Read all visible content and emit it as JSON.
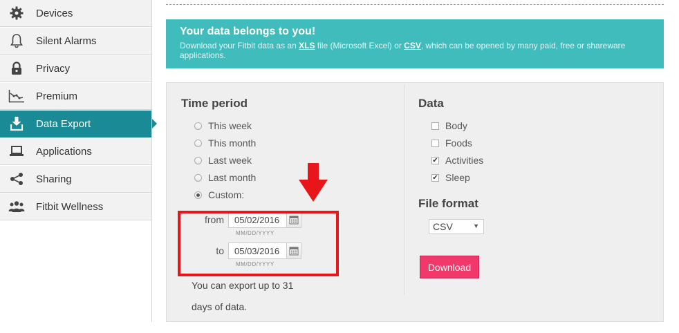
{
  "sidebar": {
    "items": [
      {
        "label": "Devices",
        "icon": "gear-icon"
      },
      {
        "label": "Silent Alarms",
        "icon": "bell-icon"
      },
      {
        "label": "Privacy",
        "icon": "lock-icon"
      },
      {
        "label": "Premium",
        "icon": "chart-line-icon"
      },
      {
        "label": "Data Export",
        "icon": "download-icon",
        "active": true
      },
      {
        "label": "Applications",
        "icon": "laptop-icon"
      },
      {
        "label": "Sharing",
        "icon": "share-icon"
      },
      {
        "label": "Fitbit Wellness",
        "icon": "people-icon"
      }
    ]
  },
  "banner": {
    "title": "Your data belongs to you!",
    "text_1": "Download your Fitbit data as an ",
    "xls_link": "XLS",
    "text_2": " file (Microsoft Excel) or ",
    "csv_link": "CSV",
    "text_3": ", which can be opened by many paid, free or shareware applications."
  },
  "time_period": {
    "heading": "Time period",
    "options": [
      "This week",
      "This month",
      "Last week",
      "Last month",
      "Custom:"
    ],
    "selected": "Custom:",
    "from_label": "from",
    "from_value": "05/02/2016",
    "to_label": "to",
    "to_value": "05/03/2016",
    "date_hint": "MM/DD/YYYY",
    "note": "You can export up to 31 days of data."
  },
  "data_section": {
    "heading": "Data",
    "options": [
      {
        "label": "Body",
        "checked": false
      },
      {
        "label": "Foods",
        "checked": false
      },
      {
        "label": "Activities",
        "checked": true
      },
      {
        "label": "Sleep",
        "checked": true
      }
    ]
  },
  "file_format": {
    "heading": "File format",
    "selected": "CSV"
  },
  "download_label": "Download",
  "colors": {
    "accent": "#1a8b96",
    "banner": "#40bcbc",
    "download": "#f0386b",
    "annotation": "#e8151a"
  }
}
